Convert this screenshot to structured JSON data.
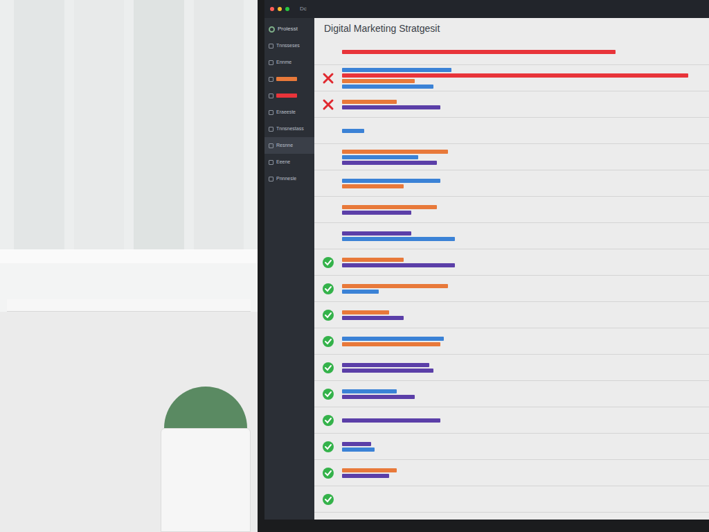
{
  "window": {
    "title": "Digital Marketing Stratgesit",
    "menu_text": "Dc"
  },
  "sidebar": {
    "brand": "Prolesst",
    "items": [
      {
        "kind": "text",
        "label": "Tnnsseses",
        "selected": false
      },
      {
        "kind": "text",
        "label": "Ennme",
        "selected": false
      },
      {
        "kind": "bar",
        "color": "#e8793a",
        "selected": false
      },
      {
        "kind": "bar",
        "color": "#e8343a",
        "selected": false
      },
      {
        "kind": "text",
        "label": "Eraeeste",
        "selected": false
      },
      {
        "kind": "text",
        "label": "Tnnsnestass",
        "selected": false
      },
      {
        "kind": "text",
        "label": "Resnne",
        "selected": true
      },
      {
        "kind": "text",
        "label": "Eeene",
        "selected": false
      },
      {
        "kind": "text",
        "label": "Pnnnesle",
        "selected": false
      }
    ]
  },
  "chart": {
    "rows": [
      {
        "status": "none",
        "bars": [
          {
            "color": "#e8343a",
            "value": 75
          }
        ]
      },
      {
        "status": "fail",
        "bars": [
          {
            "color": "#3b82d6",
            "value": 30
          },
          {
            "color": "#e8343a",
            "value": 95
          },
          {
            "color": "#e8793a",
            "value": 20
          },
          {
            "color": "#3b82d6",
            "value": 25
          }
        ]
      },
      {
        "status": "fail",
        "bars": [
          {
            "color": "#e8793a",
            "value": 15
          },
          {
            "color": "#5b3fa8",
            "value": 27
          }
        ]
      },
      {
        "status": "none",
        "bars": [
          {
            "color": "#3b82d6",
            "value": 6
          }
        ]
      },
      {
        "status": "none",
        "bars": [
          {
            "color": "#e8793a",
            "value": 29
          },
          {
            "color": "#3b82d6",
            "value": 21
          },
          {
            "color": "#5b3fa8",
            "value": 26
          }
        ]
      },
      {
        "status": "none",
        "bars": [
          {
            "color": "#3b82d6",
            "value": 27
          },
          {
            "color": "#e8793a",
            "value": 17
          }
        ]
      },
      {
        "status": "none",
        "bars": [
          {
            "color": "#e8793a",
            "value": 26
          },
          {
            "color": "#5b3fa8",
            "value": 19
          }
        ]
      },
      {
        "status": "none",
        "bars": [
          {
            "color": "#5b3fa8",
            "value": 19
          },
          {
            "color": "#3b82d6",
            "value": 31
          }
        ]
      },
      {
        "status": "pass",
        "bars": [
          {
            "color": "#e8793a",
            "value": 17
          },
          {
            "color": "#5b3fa8",
            "value": 31
          }
        ]
      },
      {
        "status": "pass",
        "bars": [
          {
            "color": "#e8793a",
            "value": 29
          },
          {
            "color": "#3b82d6",
            "value": 10
          }
        ]
      },
      {
        "status": "pass",
        "bars": [
          {
            "color": "#e8793a",
            "value": 13
          },
          {
            "color": "#5b3fa8",
            "value": 17
          }
        ]
      },
      {
        "status": "pass",
        "bars": [
          {
            "color": "#3b82d6",
            "value": 28
          },
          {
            "color": "#e8793a",
            "value": 27
          }
        ]
      },
      {
        "status": "pass",
        "bars": [
          {
            "color": "#5b3fa8",
            "value": 24
          },
          {
            "color": "#5b3fa8",
            "value": 25
          }
        ]
      },
      {
        "status": "pass",
        "bars": [
          {
            "color": "#3b82d6",
            "value": 15
          },
          {
            "color": "#5b3fa8",
            "value": 20
          }
        ]
      },
      {
        "status": "pass",
        "bars": [
          {
            "color": "#5b3fa8",
            "value": 27
          }
        ]
      },
      {
        "status": "pass",
        "bars": [
          {
            "color": "#5b3fa8",
            "value": 8
          },
          {
            "color": "#3b82d6",
            "value": 9
          }
        ]
      },
      {
        "status": "pass",
        "bars": [
          {
            "color": "#e8793a",
            "value": 15
          },
          {
            "color": "#5b3fa8",
            "value": 13
          }
        ]
      },
      {
        "status": "pass",
        "bars": []
      }
    ]
  }
}
